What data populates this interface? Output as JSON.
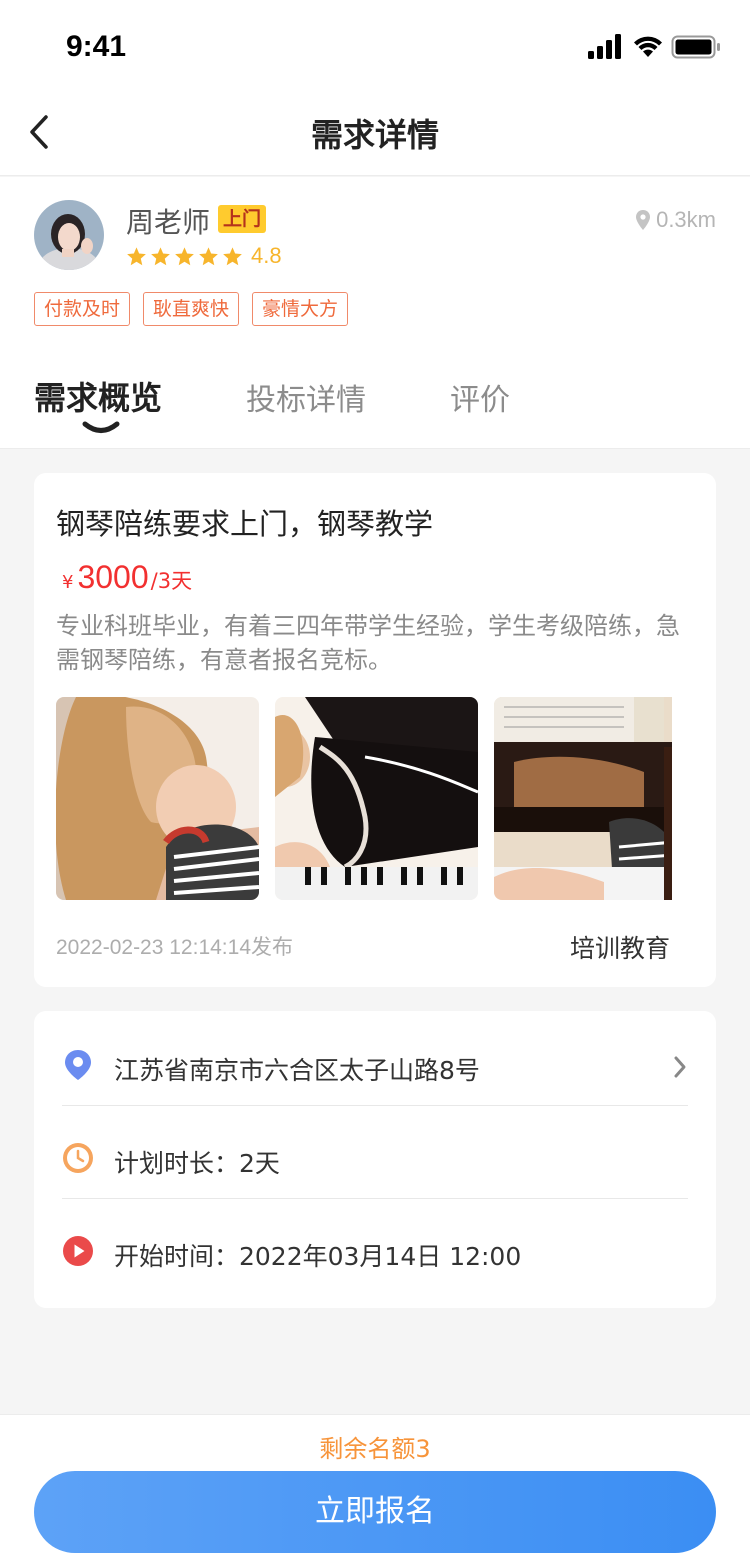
{
  "status_bar": {
    "time": "9:41"
  },
  "nav": {
    "title": "需求详情"
  },
  "profile": {
    "name": "周老师",
    "badge": "上门",
    "stars": 5,
    "rating": "4.8",
    "distance": "0.3km",
    "tags": [
      "付款及时",
      "耿直爽快",
      "豪情大方"
    ]
  },
  "tabs": [
    {
      "label": "需求概览",
      "active": true
    },
    {
      "label": "投标详情",
      "active": false
    },
    {
      "label": "评价",
      "active": false
    }
  ],
  "request": {
    "title": "钢琴陪练要求上门，钢琴教学",
    "price_symbol": "¥",
    "price": "3000",
    "price_unit": "/3天",
    "description": "专业科班毕业，有着三四年带学生经验，学生考级陪练，急需钢琴陪练，有意者报名竞标。",
    "photos": [
      "girl-with-long-hair",
      "girl-at-grand-piano",
      "hands-on-piano-keys"
    ],
    "publish_time": "2022-02-23 12:14:14发布",
    "category": "培训教育"
  },
  "info": {
    "address": "江苏省南京市六合区太子山路8号",
    "duration": "计划时长：2天",
    "start_time": "开始时间：2022年03月14日 12:00"
  },
  "footer": {
    "remaining": "剩余名额3",
    "signup_label": "立即报名"
  },
  "colors": {
    "accent_blue": "#3b8ef3",
    "price_red": "#f23030",
    "tag_orange": "#ef6a3c",
    "star_orange": "#f7b52c",
    "remaining_orange": "#f7943a"
  }
}
